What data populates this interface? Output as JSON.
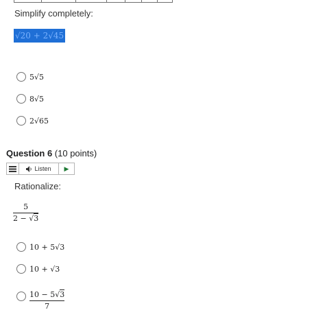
{
  "q5": {
    "prompt": "Simplify completely:",
    "expression": "√20 + 2√45",
    "options": [
      {
        "coef": "5",
        "radicand": "5"
      },
      {
        "coef": "8",
        "radicand": "5"
      },
      {
        "coef": "2",
        "radicand": "65"
      }
    ]
  },
  "q6": {
    "title_bold": "Question 6",
    "title_points": " (10 points)",
    "toolbar": {
      "listen_label": "Listen"
    },
    "prompt": "Rationalize:",
    "fraction": {
      "numerator": "5",
      "den_prefix": "2 − ",
      "den_radicand": "3"
    },
    "options": [
      {
        "prefix": "10 + 5",
        "radicand": "3"
      },
      {
        "prefix": "10 + ",
        "radicand": "3"
      },
      {
        "num_prefix": "10 − 5",
        "num_radicand": "3",
        "denominator": "7"
      }
    ]
  }
}
